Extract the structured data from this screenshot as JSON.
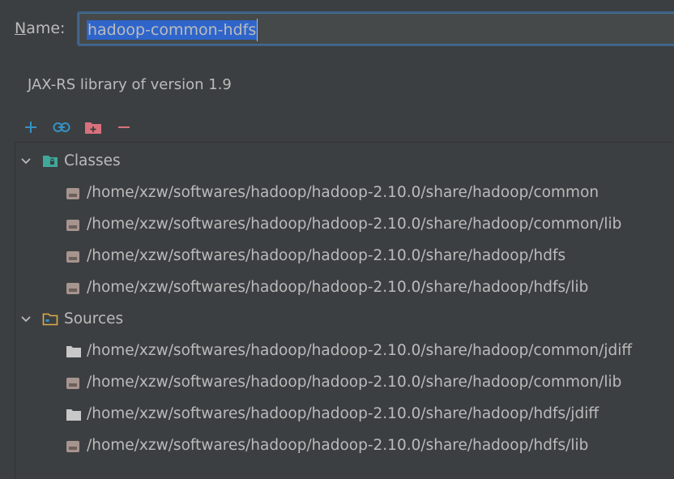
{
  "dialog": {
    "name_label": "Name:",
    "name_mnemonic": "N",
    "name_rest": "ame:",
    "name_value": "hadoop-common-hdfs",
    "library_description": "JAX-RS library of version 1.9"
  },
  "toolbar": {
    "buttons": [
      {
        "icon": "add-icon",
        "color": "#3592c4"
      },
      {
        "icon": "link-icon",
        "color": "#3592c4"
      },
      {
        "icon": "add-folder-icon",
        "color": "#d9717d"
      },
      {
        "icon": "remove-icon",
        "color": "#d9717d"
      }
    ]
  },
  "tree": {
    "classes": {
      "label": "Classes",
      "items": [
        {
          "path": "/home/xzw/softwares/hadoop/hadoop-2.10.0/share/hadoop/common",
          "icon": "jar-icon"
        },
        {
          "path": "/home/xzw/softwares/hadoop/hadoop-2.10.0/share/hadoop/common/lib",
          "icon": "jar-icon"
        },
        {
          "path": "/home/xzw/softwares/hadoop/hadoop-2.10.0/share/hadoop/hdfs",
          "icon": "jar-icon"
        },
        {
          "path": "/home/xzw/softwares/hadoop/hadoop-2.10.0/share/hadoop/hdfs/lib",
          "icon": "jar-icon"
        }
      ]
    },
    "sources": {
      "label": "Sources",
      "items": [
        {
          "path": "/home/xzw/softwares/hadoop/hadoop-2.10.0/share/hadoop/common/jdiff",
          "icon": "folder-icon"
        },
        {
          "path": "/home/xzw/softwares/hadoop/hadoop-2.10.0/share/hadoop/common/lib",
          "icon": "jar-icon"
        },
        {
          "path": "/home/xzw/softwares/hadoop/hadoop-2.10.0/share/hadoop/hdfs/jdiff",
          "icon": "folder-icon"
        },
        {
          "path": "/home/xzw/softwares/hadoop/hadoop-2.10.0/share/hadoop/hdfs/lib",
          "icon": "jar-icon"
        }
      ]
    }
  },
  "colors": {
    "background": "#3c3f41",
    "text": "#bbbbbb",
    "selection": "#2f65ca",
    "focus_border": "#3d6185",
    "classes_folder": "#3fa89a",
    "sources_folder": "#e0ac4c",
    "jar": "#a6948f"
  }
}
